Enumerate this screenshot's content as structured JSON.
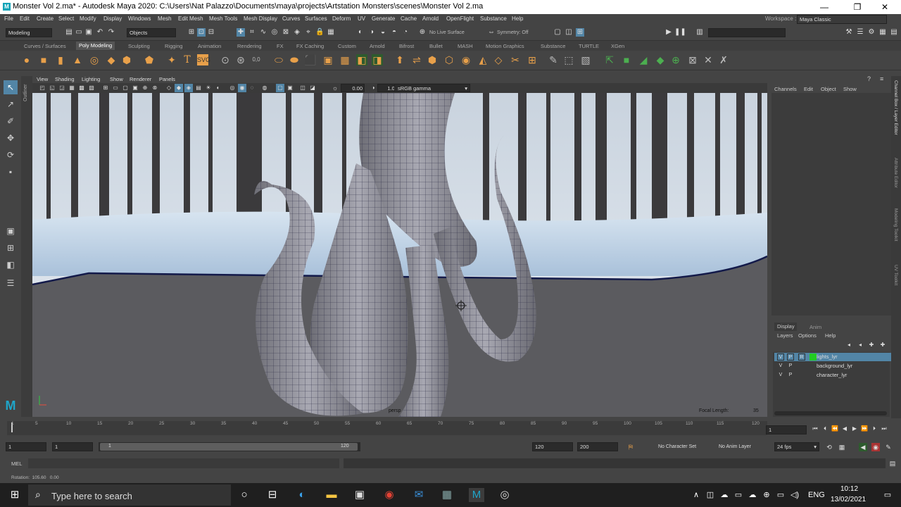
{
  "window": {
    "title": "Monster Vol 2.ma* - Autodesk Maya 2020: C:\\Users\\Nat Palazzo\\Documents\\maya\\projects\\Artstation Monsters\\scenes\\Monster Vol 2.ma",
    "minimize": "—",
    "maximize": "❐",
    "close": "✕"
  },
  "menubar": [
    "File",
    "Edit",
    "Create",
    "Select",
    "Modify",
    "Display",
    "Windows",
    "Mesh",
    "Edit Mesh",
    "Mesh Tools",
    "Mesh Display",
    "Curves",
    "Surfaces",
    "Deform",
    "UV",
    "Generate",
    "Cache",
    "Arnold",
    "OpenFlight",
    "Substance",
    "Help"
  ],
  "workspace": {
    "label": "Workspace :",
    "value": "Maya Classic"
  },
  "statusline": {
    "mode": "Modeling",
    "objects": "Objects",
    "live_surface": "No Live Surface",
    "symmetry": "Symmetry: Off"
  },
  "shelf_tabs": [
    "Curves / Surfaces",
    "Poly Modeling",
    "Sculpting",
    "Rigging",
    "Animation",
    "Rendering",
    "FX",
    "FX Caching",
    "Custom",
    "Arnold",
    "Bifrost",
    "Bullet",
    "MASH",
    "Motion Graphics",
    "Substance",
    "TURTLE",
    "XGen"
  ],
  "shelf_active": "Poly Modeling",
  "viewport": {
    "menu": [
      "View",
      "Shading",
      "Lighting",
      "Show",
      "Renderer",
      "Panels"
    ],
    "exposure": "0.00",
    "gamma": "1.00",
    "colorspace": "sRGB gamma",
    "camera": "persp",
    "focal_label": "Focal Length:",
    "focal_value": "35",
    "outliner_tab": "Outliner"
  },
  "channelbox": {
    "menu": [
      "Channels",
      "Edit",
      "Object",
      "Show"
    ],
    "side_tabs": [
      "Channel Box / Layer Editor",
      "Attribute Editor",
      "Modeling Toolkit",
      "UV Toolkit"
    ]
  },
  "layers": {
    "tabs": [
      "Display",
      "Anim"
    ],
    "menu": [
      "Layers",
      "Options",
      "Help"
    ],
    "items": [
      {
        "v": "V",
        "p": "P",
        "r": "R",
        "name": "lights_lyr",
        "selected": true,
        "color": "#22cc22"
      },
      {
        "v": "V",
        "p": "P",
        "r": "",
        "name": "background_lyr",
        "selected": false,
        "color": ""
      },
      {
        "v": "V",
        "p": "P",
        "r": "",
        "name": "character_lyr",
        "selected": false,
        "color": ""
      }
    ]
  },
  "timeline": {
    "ticks": [
      "1",
      "5",
      "10",
      "15",
      "20",
      "25",
      "30",
      "35",
      "40",
      "45",
      "50",
      "55",
      "60",
      "65",
      "70",
      "75",
      "80",
      "85",
      "90",
      "95",
      "100",
      "105",
      "110",
      "115",
      "120"
    ],
    "current_frame": "1"
  },
  "range": {
    "start": "1",
    "anim_start": "1",
    "slider_start": "1",
    "slider_end": "120",
    "end": "120",
    "anim_end": "200",
    "character_set": "No Character Set",
    "anim_layer": "No Anim Layer",
    "fps": "24 fps"
  },
  "cmdline": {
    "label": "MEL"
  },
  "helpline": {
    "text": "Rotation:  105.60   0.00"
  },
  "taskbar": {
    "search_placeholder": "Type here to search",
    "language": "ENG",
    "time": "10:12",
    "date": "13/02/2021"
  }
}
